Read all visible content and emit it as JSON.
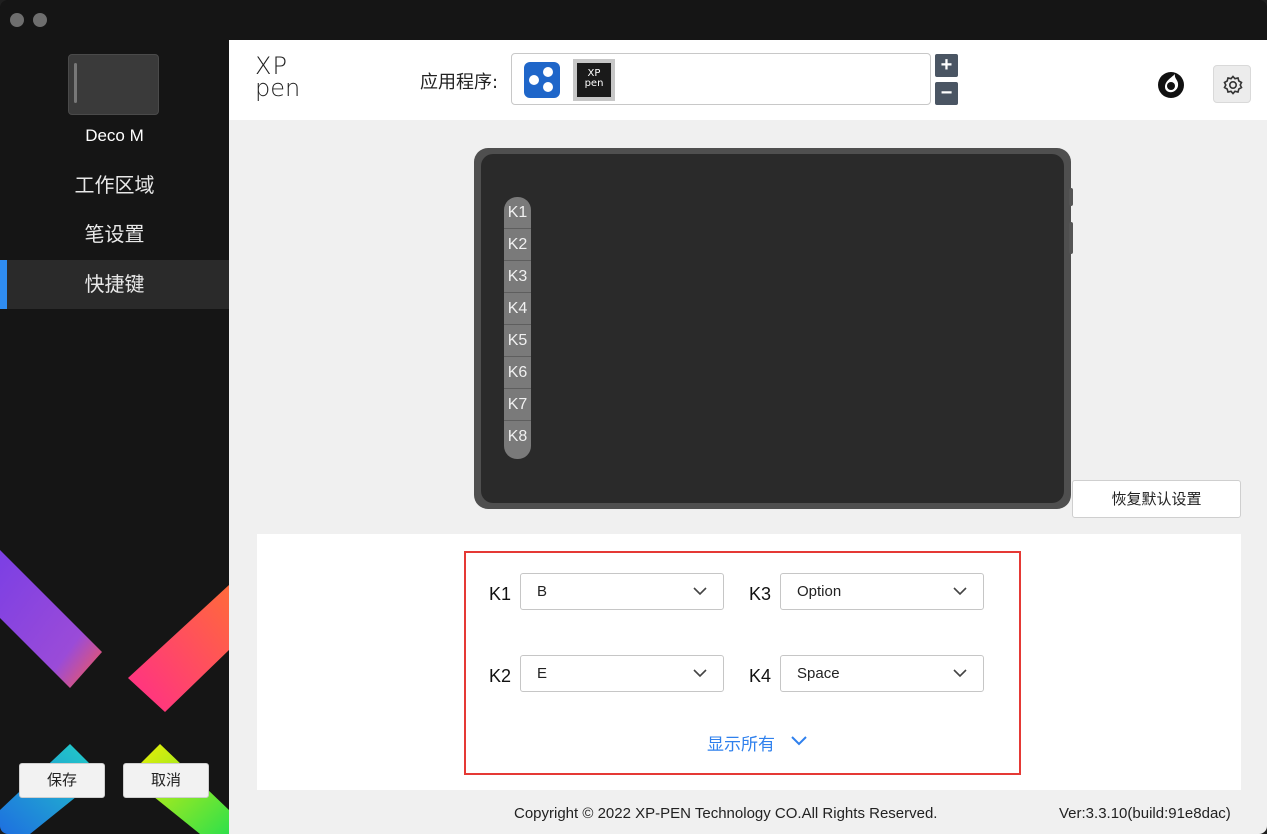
{
  "sidebar": {
    "device_name": "Deco M",
    "nav": [
      {
        "label": "工作区域"
      },
      {
        "label": "笔设置"
      },
      {
        "label": "快捷键"
      }
    ],
    "active_index": 2,
    "save_label": "保存",
    "cancel_label": "取消"
  },
  "header": {
    "logo_line1": "XP",
    "logo_line2": "pen",
    "app_label": "应用程序:",
    "app_icon_2_line1": "XP",
    "app_icon_2_line2": "pen",
    "add_label": "+",
    "remove_label": "−"
  },
  "tablet": {
    "keys": [
      "K1",
      "K2",
      "K3",
      "K4",
      "K5",
      "K6",
      "K7",
      "K8"
    ]
  },
  "reset_label": "恢复默认设置",
  "shortcuts": {
    "k1_label": "K1",
    "k1_value": "B",
    "k2_label": "K2",
    "k2_value": "E",
    "k3_label": "K3",
    "k3_value": "Option",
    "k4_label": "K4",
    "k4_value": "Space",
    "show_all": "显示所有"
  },
  "footer": {
    "copyright": "Copyright © 2022  XP-PEN Technology CO.All Rights Reserved.",
    "version": "Ver:3.3.10(build:91e8dac)"
  },
  "colors": {
    "accent": "#2f8cf0",
    "highlight_frame": "#e53935",
    "link": "#2f80ed"
  }
}
